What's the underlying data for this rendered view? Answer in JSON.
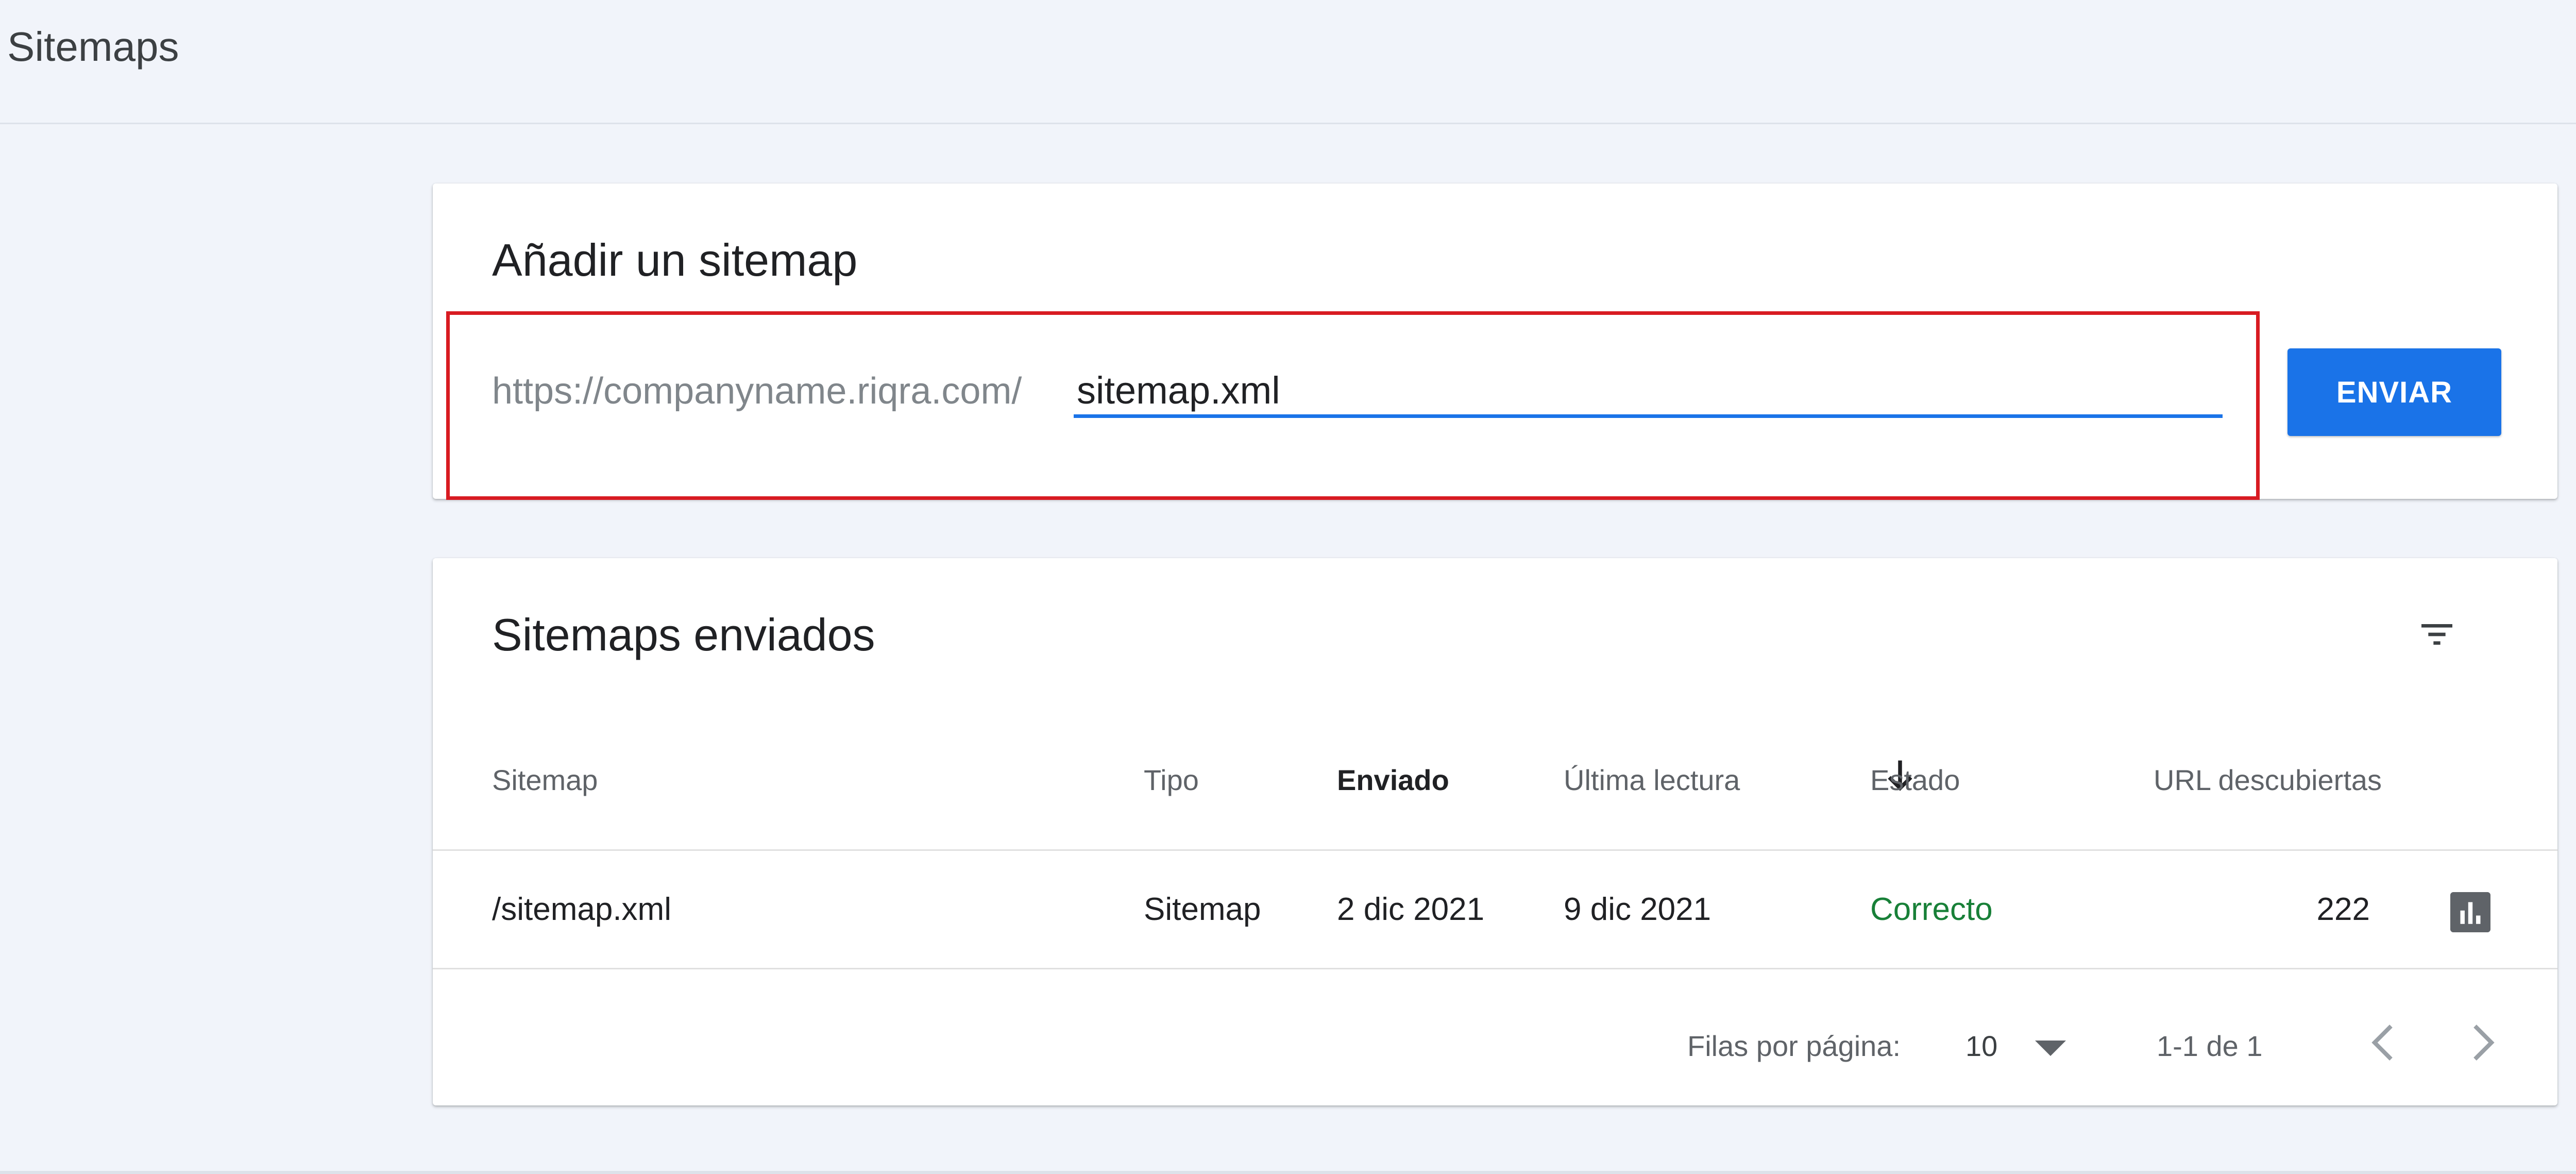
{
  "header": {
    "title": "Sitemaps"
  },
  "add_card": {
    "title": "Añadir un sitemap",
    "url_prefix": "https://companyname.riqra.com/",
    "input_value": "sitemap.xml",
    "submit_label": "ENVIAR"
  },
  "list_card": {
    "title": "Sitemaps enviados",
    "columns": [
      "Sitemap",
      "Tipo",
      "Enviado",
      "Última lectura",
      "Estado",
      "URL descubiertas"
    ],
    "sort_column": "Enviado",
    "rows": [
      {
        "sitemap": "/sitemap.xml",
        "tipo": "Sitemap",
        "enviado": "2 dic 2021",
        "ultima_lectura": "9 dic 2021",
        "estado": "Correcto",
        "urls": "222"
      }
    ],
    "footer": {
      "rows_per_page_label": "Filas por página:",
      "rows_per_page_value": "10",
      "range_label": "1-1 de 1"
    }
  },
  "icons": {
    "filter": "filter-list-icon",
    "sort": "arrow-down-icon",
    "report": "bar-chart-icon",
    "dropdown": "caret-down-icon",
    "prev": "chevron-left-icon",
    "next": "chevron-right-icon"
  },
  "colors": {
    "accent": "#1a73e8",
    "status_ok": "#188038",
    "highlight": "#d81b22",
    "background": "#f1f4fa"
  }
}
